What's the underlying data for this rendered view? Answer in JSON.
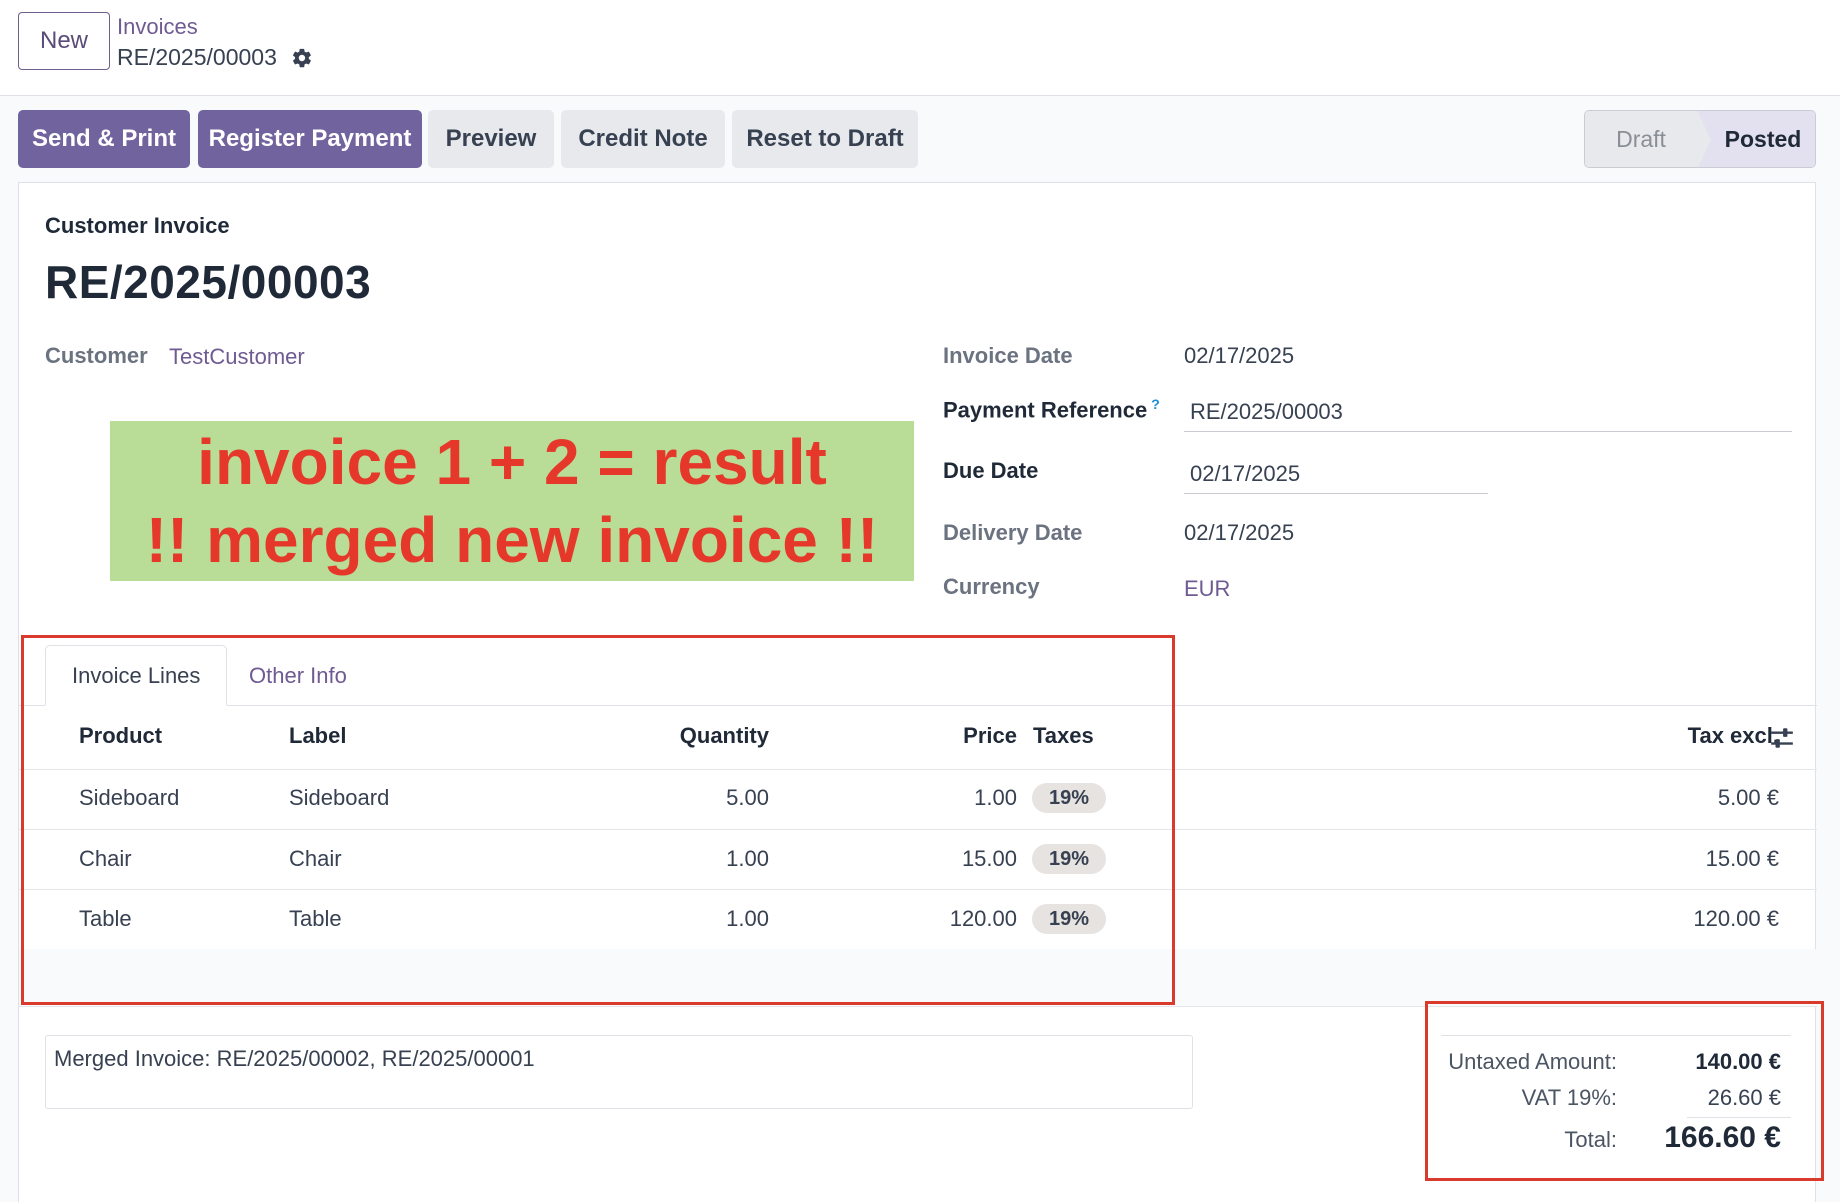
{
  "control_panel": {
    "new_label": "New",
    "breadcrumb_parent": "Invoices",
    "breadcrumb_current": "RE/2025/00003"
  },
  "actions": {
    "send_print": "Send & Print",
    "register_payment": "Register Payment",
    "preview": "Preview",
    "credit_note": "Credit Note",
    "reset_to_draft": "Reset to Draft"
  },
  "status": {
    "draft": "Draft",
    "posted": "Posted",
    "current": "Posted"
  },
  "form": {
    "doc_type": "Customer Invoice",
    "name": "RE/2025/00003",
    "customer_label": "Customer",
    "customer_value": "TestCustomer",
    "invoice_date_label": "Invoice Date",
    "invoice_date": "02/17/2025",
    "payment_ref_label": "Payment Reference",
    "payment_ref_help": "?",
    "payment_ref": "RE/2025/00003",
    "due_date_label": "Due Date",
    "due_date": "02/17/2025",
    "delivery_date_label": "Delivery Date",
    "delivery_date": "02/17/2025",
    "currency_label": "Currency",
    "currency": "EUR"
  },
  "annotation": {
    "line1": "invoice 1 + 2 = result",
    "line2": "!! merged new invoice !!"
  },
  "tabs": {
    "invoice_lines": "Invoice Lines",
    "other_info": "Other Info"
  },
  "table": {
    "headers": {
      "product": "Product",
      "label": "Label",
      "quantity": "Quantity",
      "price": "Price",
      "taxes": "Taxes",
      "tax_excl": "Tax excl."
    },
    "rows": [
      {
        "product": "Sideboard",
        "label": "Sideboard",
        "quantity": "5.00",
        "price": "1.00",
        "tax": "19%",
        "subtotal": "5.00 €"
      },
      {
        "product": "Chair",
        "label": "Chair",
        "quantity": "1.00",
        "price": "15.00",
        "tax": "19%",
        "subtotal": "15.00 €"
      },
      {
        "product": "Table",
        "label": "Table",
        "quantity": "1.00",
        "price": "120.00",
        "tax": "19%",
        "subtotal": "120.00 €"
      }
    ]
  },
  "narration": "Merged Invoice: RE/2025/00002, RE/2025/00001",
  "totals": {
    "untaxed_label": "Untaxed Amount:",
    "untaxed_value": "140.00 €",
    "vat_label": "VAT 19%:",
    "vat_value": "26.60 €",
    "total_label": "Total:",
    "total_value": "166.60 €"
  },
  "colors": {
    "primary": "#71639e",
    "link": "#6f5a92",
    "annotation_red": "#e5372a",
    "annotation_bg": "#b9dc96",
    "highlight_box": "#d93a2b"
  }
}
